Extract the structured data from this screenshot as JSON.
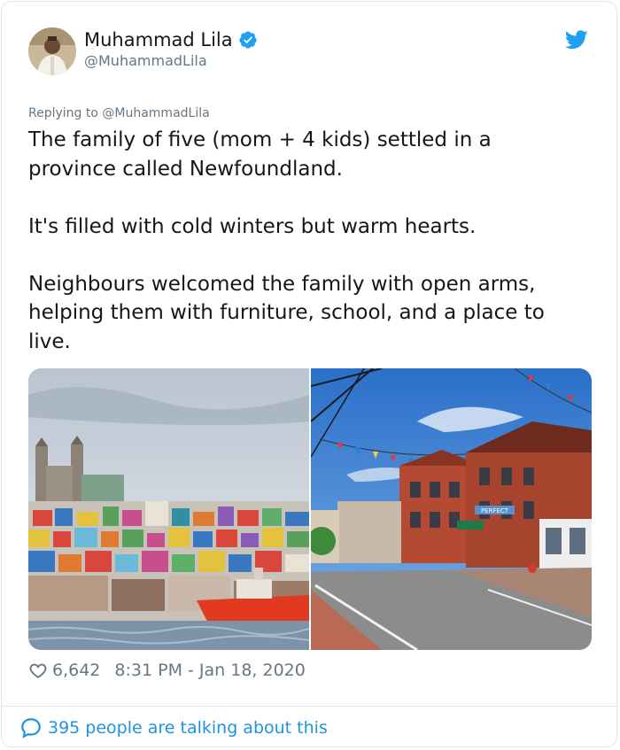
{
  "user": {
    "name": "Muhammad Lila",
    "handle": "@MuhammadLila",
    "verified": true
  },
  "reply_prefix": "Replying to ",
  "reply_handle": "@MuhammadLila",
  "tweet": {
    "text": "The family of five (mom + 4 kids) settled in a\nprovince called Newfoundland.\n\nIt's filled with cold winters but warm hearts.\n\nNeighbours welcomed the family with open arms,\nhelping them with furniture, school, and a place to\nlive."
  },
  "media": {
    "left_photo": "harbour-town-photo",
    "right_photo": "street-photo",
    "sign_text": "PERFECT"
  },
  "footer": {
    "likes": "6,642",
    "timestamp": "8:31 PM - Jan 18, 2020",
    "conversation": "395 people are talking about this"
  },
  "colors": {
    "accent": "#1da1f2",
    "link": "#1b95e0",
    "secondary_text": "#657786",
    "border": "#e1e8ed"
  },
  "icons": [
    "verified-badge-icon",
    "twitter-bird-icon",
    "heart-icon",
    "speech-bubble-icon"
  ]
}
